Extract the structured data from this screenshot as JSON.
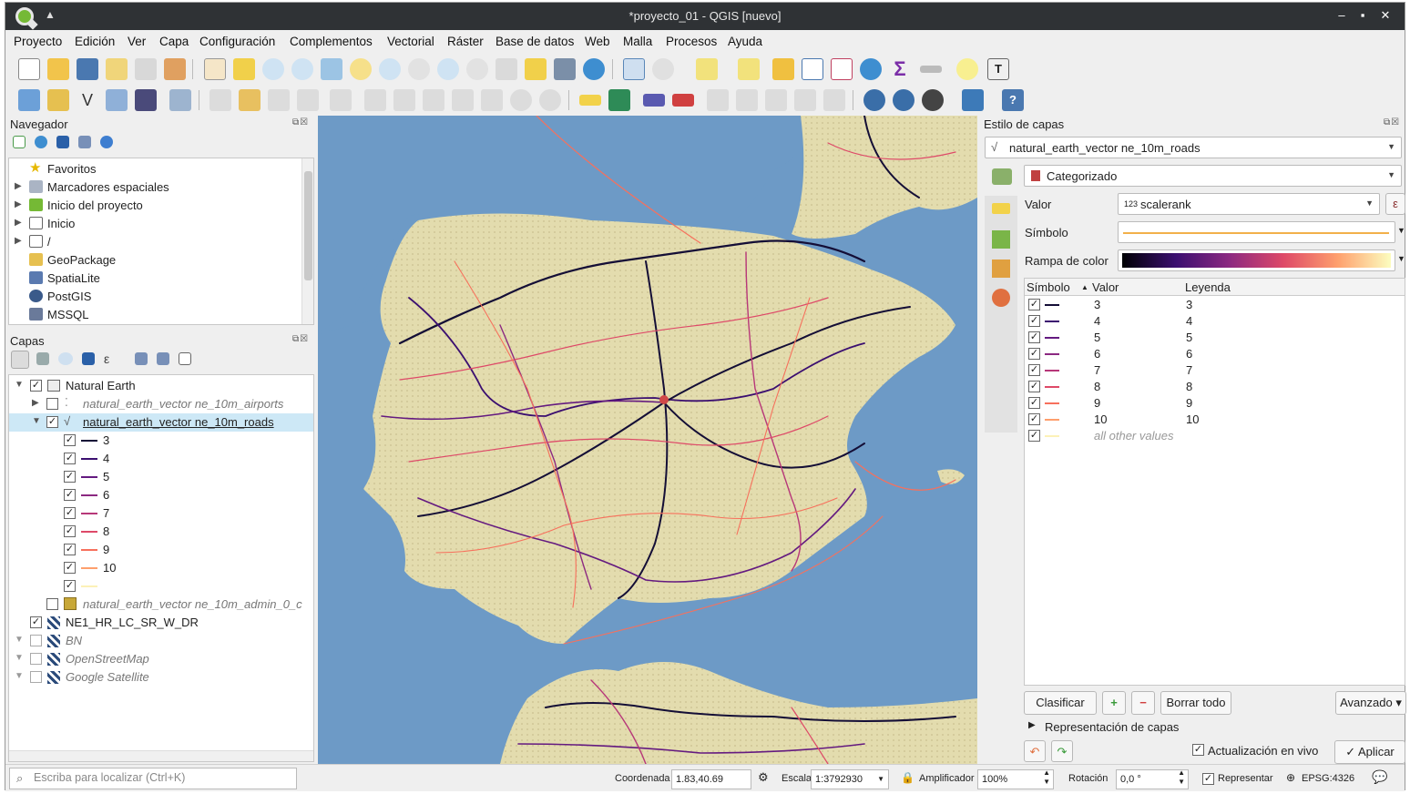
{
  "window": {
    "title": "*proyecto_01 - QGIS [nuevo]"
  },
  "menu": [
    "Proyecto",
    "Edición",
    "Ver",
    "Capa",
    "Configuración",
    "Complementos",
    "Vectorial",
    "Ráster",
    "Base de datos",
    "Web",
    "Malla",
    "Procesos",
    "Ayuda"
  ],
  "navigator": {
    "title": "Navegador",
    "items": [
      {
        "label": "Favoritos",
        "icon": "star-icon",
        "expandable": false
      },
      {
        "label": "Marcadores espaciales",
        "icon": "bookmark-icon",
        "expandable": true
      },
      {
        "label": "Inicio del proyecto",
        "icon": "qgis-project-icon",
        "expandable": true
      },
      {
        "label": "Inicio",
        "icon": "home-folder-icon",
        "expandable": true
      },
      {
        "label": "/",
        "icon": "folder-icon",
        "expandable": true
      },
      {
        "label": "GeoPackage",
        "icon": "geopackage-icon",
        "expandable": false
      },
      {
        "label": "SpatiaLite",
        "icon": "spatialite-icon",
        "expandable": false
      },
      {
        "label": "PostGIS",
        "icon": "postgis-icon",
        "expandable": false
      },
      {
        "label": "MSSQL",
        "icon": "mssql-icon",
        "expandable": false
      }
    ]
  },
  "layers": {
    "title": "Capas",
    "group": {
      "label": "Natural Earth",
      "checked": true
    },
    "airports": {
      "label": "natural_earth_vector ne_10m_airports",
      "checked": false
    },
    "roads": {
      "label": "natural_earth_vector ne_10m_roads",
      "checked": true
    },
    "road_classes": [
      {
        "label": "3",
        "color": "#140e36"
      },
      {
        "label": "4",
        "color": "#3b0f70"
      },
      {
        "label": "5",
        "color": "#641a80"
      },
      {
        "label": "6",
        "color": "#8c2981"
      },
      {
        "label": "7",
        "color": "#b73779"
      },
      {
        "label": "8",
        "color": "#de4968"
      },
      {
        "label": "9",
        "color": "#f7705c"
      },
      {
        "label": "10",
        "color": "#fe9f6d"
      },
      {
        "label": "",
        "color": "#fcf1b8"
      }
    ],
    "admin": {
      "label": "natural_earth_vector ne_10m_admin_0_c",
      "checked": false
    },
    "raster_layers": [
      {
        "label": "NE1_HR_LC_SR_W_DR",
        "checked": true,
        "italic": false
      },
      {
        "label": "BN",
        "checked": false,
        "italic": true
      },
      {
        "label": "OpenStreetMap",
        "checked": false,
        "italic": true
      },
      {
        "label": "Google Satellite",
        "checked": false,
        "italic": true
      }
    ]
  },
  "style_panel": {
    "title": "Estilo de capas",
    "layer_combo": "natural_earth_vector ne_10m_roads",
    "renderer": "Categorizado",
    "value_label": "Valor",
    "value_field": "scalerank",
    "value_field_type": "123",
    "symbol_label": "Símbolo",
    "ramp_label": "Rampa de color",
    "columns": {
      "symbol": "Símbolo",
      "value": "Valor",
      "legend": "Leyenda"
    },
    "rows": [
      {
        "value": "3",
        "legend": "3",
        "color": "#140e36"
      },
      {
        "value": "4",
        "legend": "4",
        "color": "#3b0f70"
      },
      {
        "value": "5",
        "legend": "5",
        "color": "#641a80"
      },
      {
        "value": "6",
        "legend": "6",
        "color": "#8c2981"
      },
      {
        "value": "7",
        "legend": "7",
        "color": "#b73779"
      },
      {
        "value": "8",
        "legend": "8",
        "color": "#de4968"
      },
      {
        "value": "9",
        "legend": "9",
        "color": "#f7705c"
      },
      {
        "value": "10",
        "legend": "10",
        "color": "#fe9f6d"
      },
      {
        "value": "all other values",
        "legend": "",
        "color": "#fcf1b8"
      }
    ],
    "classify_btn": "Clasificar",
    "delete_all_btn": "Borrar todo",
    "advanced_btn": "Avanzado",
    "layer_rendering": "Representación de capas",
    "live_update": "Actualización en vivo",
    "apply_btn": "Aplicar"
  },
  "statusbar": {
    "locator_placeholder": "Escriba para localizar (Ctrl+K)",
    "coord_label": "Coordenada",
    "coord_value": "1.83,40.69",
    "scale_label": "Escala",
    "scale_value": "1:3792930",
    "magnifier_label": "Amplificador",
    "magnifier_value": "100%",
    "rotation_label": "Rotación",
    "rotation_value": "0,0 °",
    "render_label": "Representar",
    "crs": "EPSG:4326"
  }
}
